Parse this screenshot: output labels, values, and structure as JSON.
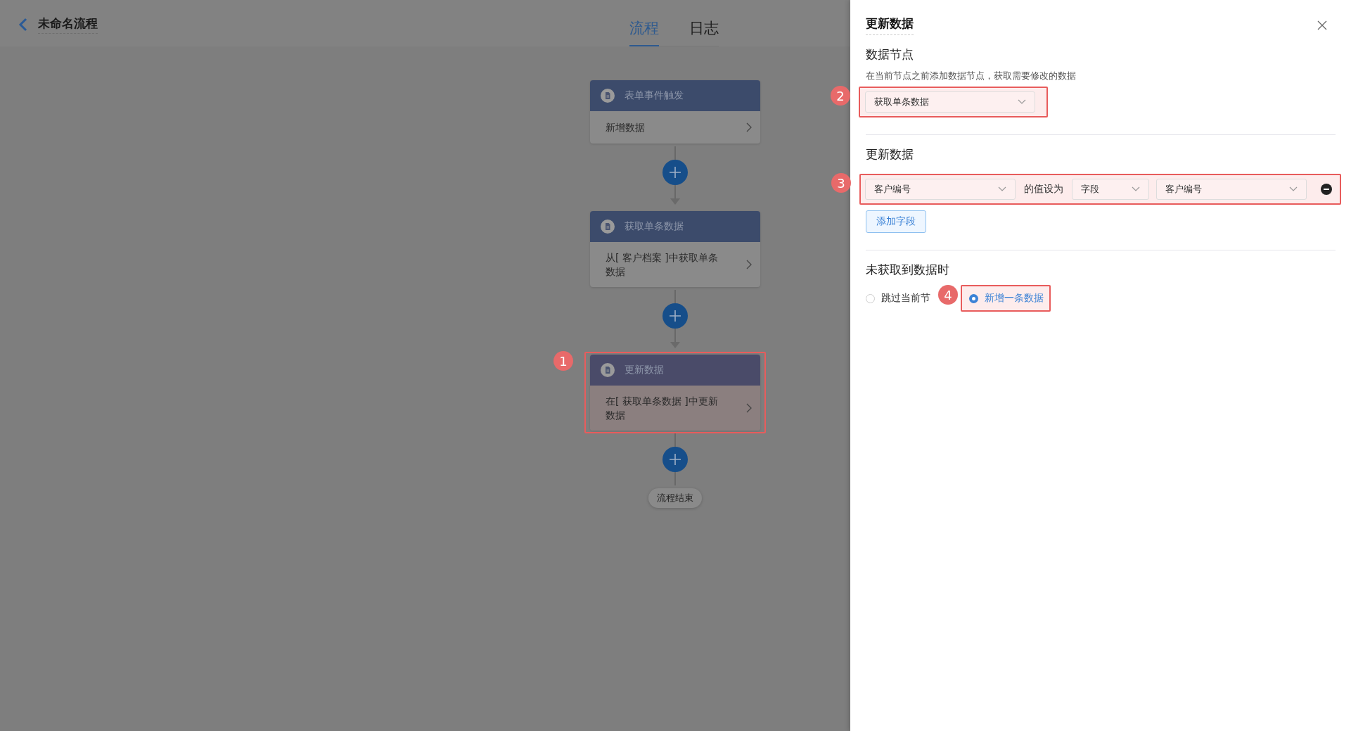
{
  "header": {
    "title": "未命名流程",
    "tabs": [
      {
        "label": "流程",
        "selected": true
      },
      {
        "label": "日志",
        "selected": false
      }
    ]
  },
  "flow": {
    "nodes": [
      {
        "title": "表单事件触发",
        "description": "新增数据"
      },
      {
        "title": "获取单条数据",
        "description": "从[ 客户档案 ]中获取单条数据"
      },
      {
        "title": "更新数据",
        "description": "在[ 获取单条数据 ]中更新数据",
        "callout": "1"
      }
    ],
    "end": "流程结束"
  },
  "panel": {
    "title": "更新数据",
    "data_node": {
      "heading": "数据节点",
      "hint": "在当前节点之前添加数据节点，获取需要修改的数据",
      "value": "获取单条数据",
      "callout": "2"
    },
    "update": {
      "heading": "更新数据",
      "rows": [
        {
          "field": "客户编号",
          "connector": "的值设为",
          "type": "字段",
          "value": "客户编号"
        }
      ],
      "callout": "3",
      "add_button": "添加字段"
    },
    "fallback": {
      "heading": "未获取到数据时",
      "options": [
        {
          "label": "跳过当前节",
          "selected": false
        },
        {
          "label": "新增一条数据",
          "selected": true,
          "callout": "4"
        }
      ]
    }
  }
}
